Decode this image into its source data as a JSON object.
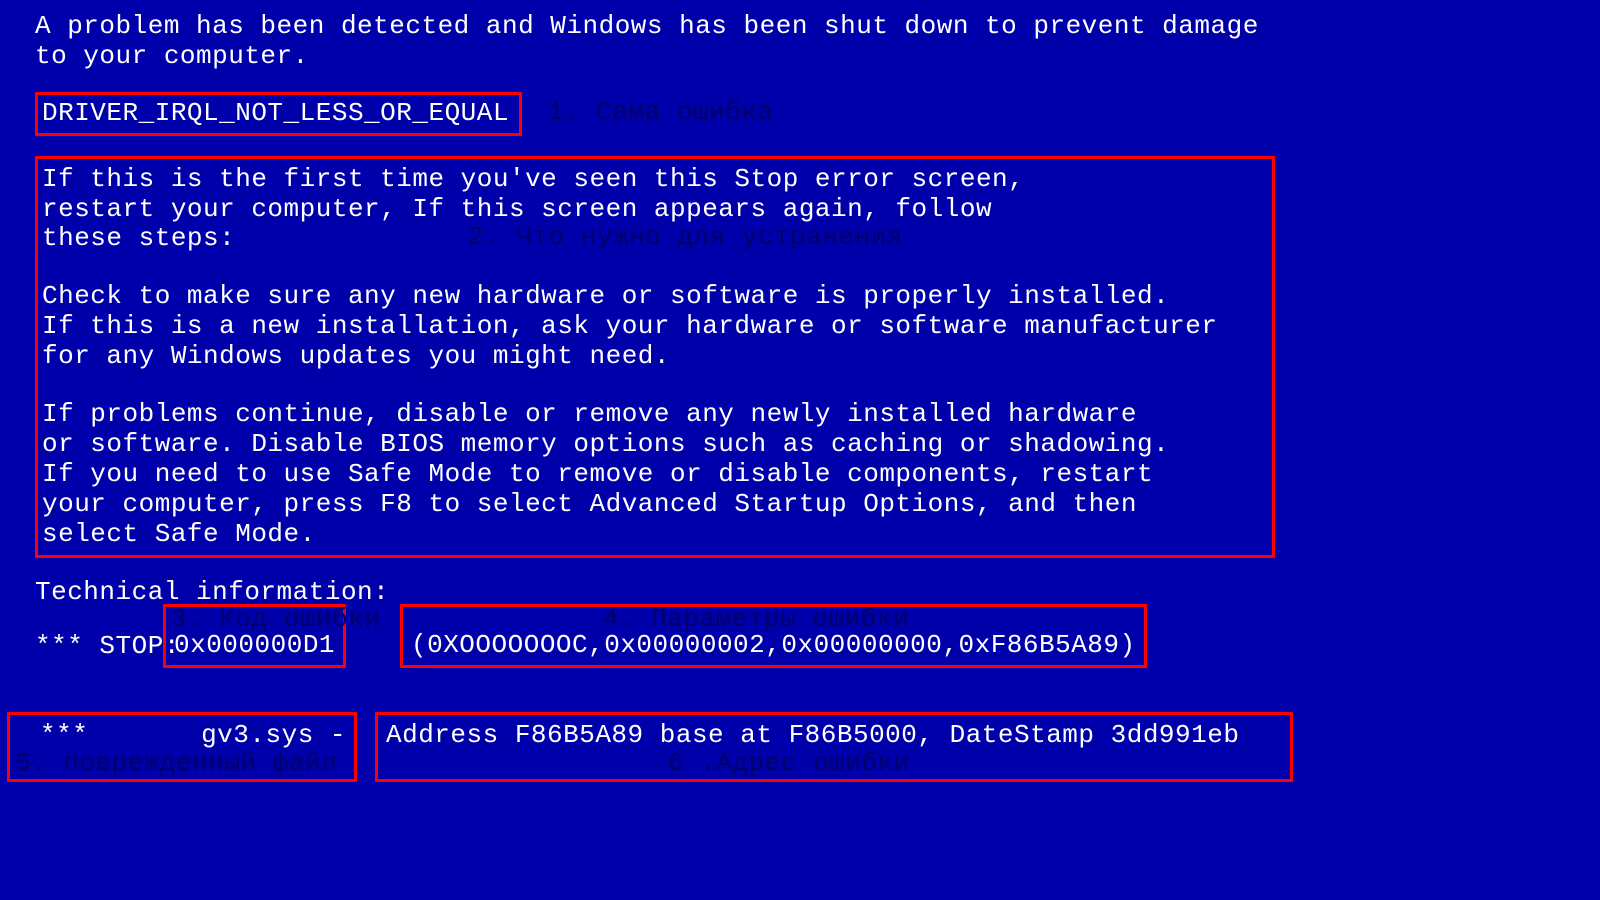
{
  "colors": {
    "background": "#0000AA",
    "text": "#FFFFFF",
    "highlight_border": "#FF0000",
    "annotation_text": "#000066"
  },
  "intro": "A problem has been detected and Windows has been shut down to prevent damage\nto your computer.",
  "error_name": "DRIVER_IRQL_NOT_LESS_OR_EQUAL",
  "annotations": {
    "a1": "1. Сама ошибка",
    "a2": "2. Что нужно для устранения",
    "a3": "3. Код ошибки",
    "a4": "4. Параметры ошибки",
    "a5": "5. поврежденный файл",
    "a6": "6 .Адрес ошибки"
  },
  "instructions": {
    "p1": "If this is the first time you've seen this Stop error screen,\nrestart your computer, If this screen appears again, follow\nthese steps:",
    "p2": "Check to make sure any new hardware or software is properly installed.\nIf this is a new installation, ask your hardware or software manufacturer\nfor any Windows updates you might need.",
    "p3": "If problems continue, disable or remove any newly installed hardware\nor software. Disable BIOS memory options such as caching or shadowing.\nIf you need to use Safe Mode to remove or disable components, restart\nyour computer, press F8 to select Advanced Startup Options, and then\nselect Safe Mode."
  },
  "technical_header": "Technical information:",
  "stop_prefix": "*** STOP:",
  "stop_code": "0x000000D1",
  "stop_params": "(0XOOOOOOOC,0x00000002,0x00000000,0xF86B5A89)",
  "file_line": "***       gv3.sys -",
  "address_line": "Address F86B5A89 base at F86B5000, DateStamp 3dd991eb"
}
